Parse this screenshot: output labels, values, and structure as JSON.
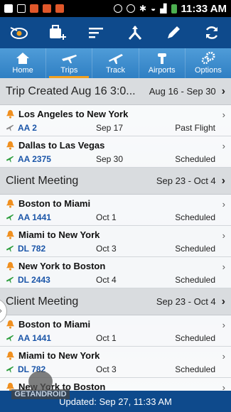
{
  "status_bar": {
    "time": "11:33 AM",
    "battery_color": "#4caf50"
  },
  "action_bar": {
    "icons": [
      "app-logo-icon",
      "add-trip-icon",
      "sort-icon",
      "route-split-icon",
      "edit-icon",
      "refresh-icon"
    ]
  },
  "tabs": [
    {
      "label": "Home",
      "icon": "home-icon",
      "active": false
    },
    {
      "label": "Trips",
      "icon": "trips-icon",
      "active": true
    },
    {
      "label": "Track",
      "icon": "track-plane-icon",
      "active": false
    },
    {
      "label": "Airports",
      "icon": "airport-tower-icon",
      "active": false
    },
    {
      "label": "Options",
      "icon": "gears-icon",
      "active": false
    }
  ],
  "sections": [
    {
      "title": "Trip Created Aug 16 3:0...",
      "dates": "Aug 16 - Sep 30",
      "flights": [
        {
          "route": "Los Angeles to New York",
          "flight": "AA 2",
          "date": "Sep 17",
          "status": "Past Flight",
          "past": true
        },
        {
          "route": "Dallas to Las Vegas",
          "flight": "AA 2375",
          "date": "Sep 30",
          "status": "Scheduled",
          "past": false
        }
      ]
    },
    {
      "title": "Client Meeting",
      "dates": "Sep 23 - Oct 4",
      "flights": [
        {
          "route": "Boston to Miami",
          "flight": "AA 1441",
          "date": "Oct 1",
          "status": "Scheduled",
          "past": false
        },
        {
          "route": "Miami to New York",
          "flight": "DL 782",
          "date": "Oct 3",
          "status": "Scheduled",
          "past": false
        },
        {
          "route": "New York to Boston",
          "flight": "DL 2443",
          "date": "Oct 4",
          "status": "Scheduled",
          "past": false
        }
      ]
    },
    {
      "title": "Client Meeting",
      "dates": "Sep 23 - Oct 4",
      "flights": [
        {
          "route": "Boston to Miami",
          "flight": "AA 1441",
          "date": "Oct 1",
          "status": "Scheduled",
          "past": false
        },
        {
          "route": "Miami to New York",
          "flight": "DL 782",
          "date": "Oct 3",
          "status": "Scheduled",
          "past": false
        },
        {
          "route": "New York to Boston",
          "flight": "",
          "date": "",
          "status": "",
          "past": false
        }
      ]
    }
  ],
  "bottom_bar": {
    "text": "Updated: Sep 27, 11:33 AM"
  },
  "watermark": {
    "text": "GETANDROID"
  },
  "colors": {
    "action_bar": "#0e4a8c",
    "tab_bar": "#3a8acb",
    "tab_active_indicator": "#f0a020",
    "bell": "#f09020",
    "plane_active": "#2e9e3e",
    "plane_past": "#888888",
    "flight_number": "#1a55a8"
  }
}
